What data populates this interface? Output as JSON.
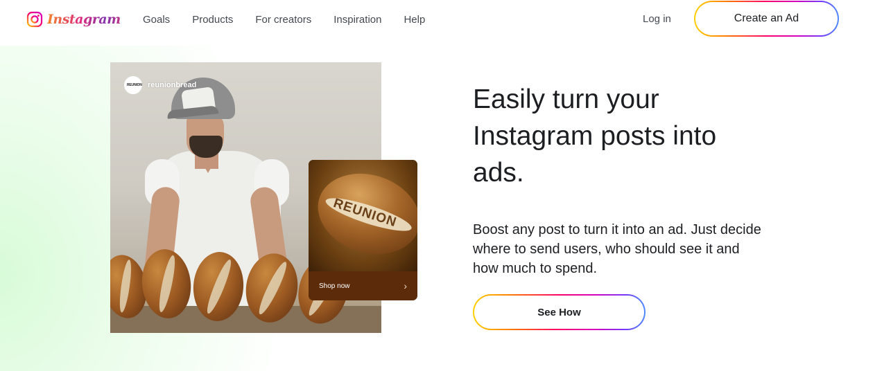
{
  "header": {
    "logo_text": "Instagram",
    "nav": [
      {
        "label": "Goals"
      },
      {
        "label": "Products"
      },
      {
        "label": "For creators"
      },
      {
        "label": "Inspiration"
      },
      {
        "label": "Help"
      }
    ],
    "login_label": "Log in",
    "cta_label": "Create an Ad"
  },
  "hero": {
    "account_name": "reunionbread",
    "product_card": {
      "image_text": "REUNION",
      "cta_label": "Shop now",
      "chevron_icon": "chevron-right-icon"
    },
    "headline": "Easily turn your Instagram posts into ads.",
    "description": "Boost any post to turn it into an ad. Just decide where to send users, who should see it and how much to spend.",
    "button_label": "See How"
  },
  "colors": {
    "gradient": [
      "#ffd100",
      "#ff7a00",
      "#ff0069",
      "#d300c5",
      "#7638fa",
      "#4f8cff"
    ],
    "card_bar": "#5c2c0a",
    "hero_tint": "#d8fbd8"
  }
}
